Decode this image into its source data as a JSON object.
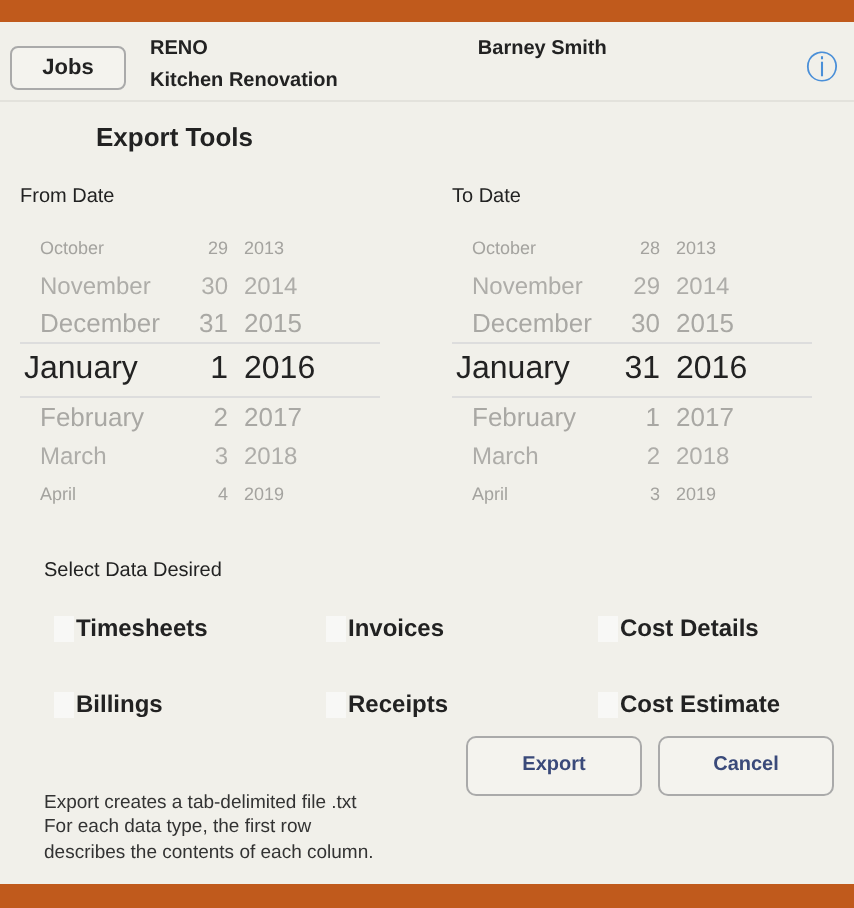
{
  "header": {
    "jobs_button": "Jobs",
    "job_code": "RENO",
    "job_name": "Kitchen Renovation",
    "person": "Barney Smith",
    "info_icon": "ⓘ"
  },
  "title": "Export Tools",
  "pickers": [
    {
      "label": "From Date",
      "rows": [
        {
          "month": "October",
          "day": "29",
          "year": "2013",
          "selected": false
        },
        {
          "month": "November",
          "day": "30",
          "year": "2014",
          "selected": false
        },
        {
          "month": "December",
          "day": "31",
          "year": "2015",
          "selected": false
        },
        {
          "month": "January",
          "day": "1",
          "year": "2016",
          "selected": true
        },
        {
          "month": "February",
          "day": "2",
          "year": "2017",
          "selected": false
        },
        {
          "month": "March",
          "day": "3",
          "year": "2018",
          "selected": false
        },
        {
          "month": "April",
          "day": "4",
          "year": "2019",
          "selected": false
        }
      ]
    },
    {
      "label": "To Date",
      "rows": [
        {
          "month": "October",
          "day": "28",
          "year": "2013",
          "selected": false
        },
        {
          "month": "November",
          "day": "29",
          "year": "2014",
          "selected": false
        },
        {
          "month": "December",
          "day": "30",
          "year": "2015",
          "selected": false
        },
        {
          "month": "January",
          "day": "31",
          "year": "2016",
          "selected": true
        },
        {
          "month": "February",
          "day": "1",
          "year": "2017",
          "selected": false
        },
        {
          "month": "March",
          "day": "2",
          "year": "2018",
          "selected": false
        },
        {
          "month": "April",
          "day": "3",
          "year": "2019",
          "selected": false
        }
      ]
    }
  ],
  "select_label": "Select Data Desired",
  "options": [
    {
      "label": "Timesheets",
      "checked": false
    },
    {
      "label": "Invoices",
      "checked": false
    },
    {
      "label": "Cost Details",
      "checked": false
    },
    {
      "label": "Billings",
      "checked": false
    },
    {
      "label": "Receipts",
      "checked": false
    },
    {
      "label": "Cost Estimate",
      "checked": false
    }
  ],
  "note": "Export creates a tab-delimited file .txt\nFor each data type,  the first row\ndescribes the contents of each column.",
  "buttons": [
    "Export",
    "Cancel"
  ]
}
